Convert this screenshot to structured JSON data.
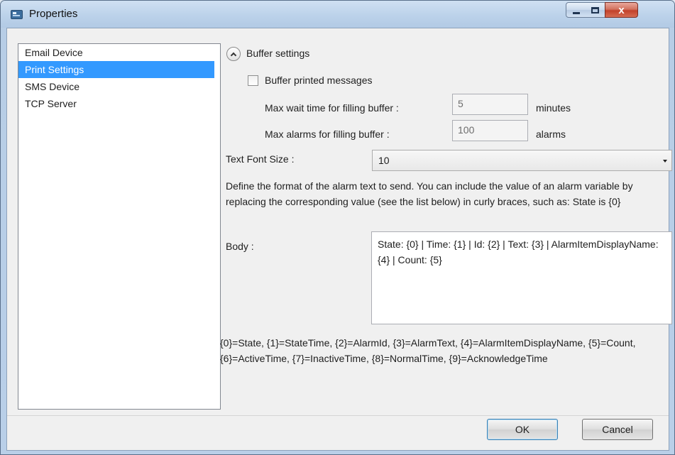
{
  "window": {
    "title": "Properties",
    "minimize_label": "",
    "maximize_label": "",
    "close_label": "x"
  },
  "sidebar": {
    "items": [
      {
        "label": "Email Device"
      },
      {
        "label": "Print Settings",
        "selected": true
      },
      {
        "label": "SMS Device"
      },
      {
        "label": "TCP Server"
      }
    ]
  },
  "buffer": {
    "section_label": "Buffer settings",
    "expanded": true,
    "checkbox_label": "Buffer printed messages",
    "checked": false,
    "wait_label": "Max wait time for filling buffer :",
    "wait_value": "5",
    "wait_unit": "minutes",
    "alarms_label": "Max alarms for filling buffer :",
    "alarms_value": "100",
    "alarms_unit": "alarms"
  },
  "font_size": {
    "label": "Text Font Size :",
    "value": "10"
  },
  "description": "Define the format of the alarm text to send. You can include the value of an alarm variable by replacing the corresponding value (see the list below) in curly braces, such as: State is {0}",
  "body": {
    "label": "Body :",
    "value": "State: {0} | Time: {1} | Id: {2} | Text: {3} | AlarmItemDisplayName: {4} | Count: {5}"
  },
  "legend": "{0}=State, {1}=StateTime, {2}=AlarmId, {3}=AlarmText, {4}=AlarmItemDisplayName, {5}=Count, {6}=ActiveTime, {7}=InactiveTime, {8}=NormalTime, {9}=AcknowledgeTime",
  "buttons": {
    "ok": "OK",
    "cancel": "Cancel"
  },
  "colors": {
    "selection": "#3399ff",
    "close_button": "#c2412a"
  }
}
